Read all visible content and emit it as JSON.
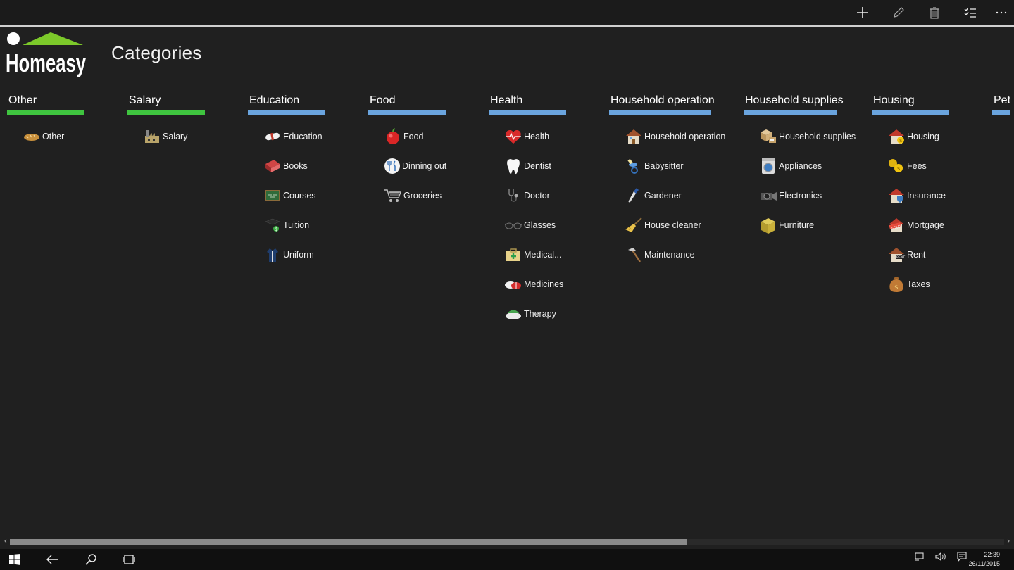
{
  "app": {
    "title": "Categories",
    "logo_text": "Homeasy",
    "brand_green": "#7cc92a"
  },
  "commandbar": {
    "add_icon": "plus-icon",
    "edit_icon": "pencil-icon",
    "delete_icon": "trash-icon",
    "select_icon": "checklist-icon",
    "more_icon": "more-icon"
  },
  "columns": [
    {
      "header": "Other",
      "accent": "#3fc43f",
      "items": [
        {
          "label": "Other",
          "icon": "bread-icon"
        }
      ]
    },
    {
      "header": "Salary",
      "accent": "#3fc43f",
      "items": [
        {
          "label": "Salary",
          "icon": "factory-icon"
        }
      ]
    },
    {
      "header": "Education",
      "accent": "#6aa4de",
      "items": [
        {
          "label": "Education",
          "icon": "diploma-icon"
        },
        {
          "label": "Books",
          "icon": "book-icon"
        },
        {
          "label": "Courses",
          "icon": "chalkboard-icon"
        },
        {
          "label": "Tuition",
          "icon": "grad-cap-icon"
        },
        {
          "label": "Uniform",
          "icon": "uniform-icon"
        }
      ]
    },
    {
      "header": "Food",
      "accent": "#6aa4de",
      "items": [
        {
          "label": "Food",
          "icon": "apple-icon"
        },
        {
          "label": "Dinning out",
          "icon": "cutlery-icon"
        },
        {
          "label": "Groceries",
          "icon": "cart-icon"
        }
      ]
    },
    {
      "header": "Health",
      "accent": "#6aa4de",
      "items": [
        {
          "label": "Health",
          "icon": "heartbeat-icon"
        },
        {
          "label": "Dentist",
          "icon": "tooth-icon"
        },
        {
          "label": "Doctor",
          "icon": "stethoscope-icon"
        },
        {
          "label": "Glasses",
          "icon": "glasses-icon"
        },
        {
          "label": "Medical...",
          "icon": "medkit-icon"
        },
        {
          "label": "Medicines",
          "icon": "pills-icon"
        },
        {
          "label": "Therapy",
          "icon": "therapy-icon"
        }
      ]
    },
    {
      "header": "Household operation",
      "accent": "#6aa4de",
      "items": [
        {
          "label": "Household operation",
          "icon": "house-icon"
        },
        {
          "label": "Babysitter",
          "icon": "pacifier-icon"
        },
        {
          "label": "Gardener",
          "icon": "trowel-icon"
        },
        {
          "label": "House cleaner",
          "icon": "broom-icon"
        },
        {
          "label": "Maintenance",
          "icon": "hammer-icon"
        }
      ]
    },
    {
      "header": "Household supplies",
      "accent": "#6aa4de",
      "items": [
        {
          "label": "Household supplies",
          "icon": "boxes-icon"
        },
        {
          "label": "Appliances",
          "icon": "washer-icon"
        },
        {
          "label": "Electronics",
          "icon": "camera-icon"
        },
        {
          "label": "Furniture",
          "icon": "furniture-icon"
        }
      ]
    },
    {
      "header": "Housing",
      "accent": "#6aa4de",
      "items": [
        {
          "label": "Housing",
          "icon": "house-coin-icon"
        },
        {
          "label": "Fees",
          "icon": "coins-icon"
        },
        {
          "label": "Insurance",
          "icon": "house-shield-icon"
        },
        {
          "label": "Mortgage",
          "icon": "sold-house-icon"
        },
        {
          "label": "Rent",
          "icon": "rent-house-icon"
        },
        {
          "label": "Taxes",
          "icon": "moneybag-icon"
        }
      ]
    },
    {
      "header": "Pets",
      "accent": "#6aa4de",
      "items": []
    }
  ],
  "taskbar": {
    "time": "22:39",
    "date": "26/11/2015"
  }
}
